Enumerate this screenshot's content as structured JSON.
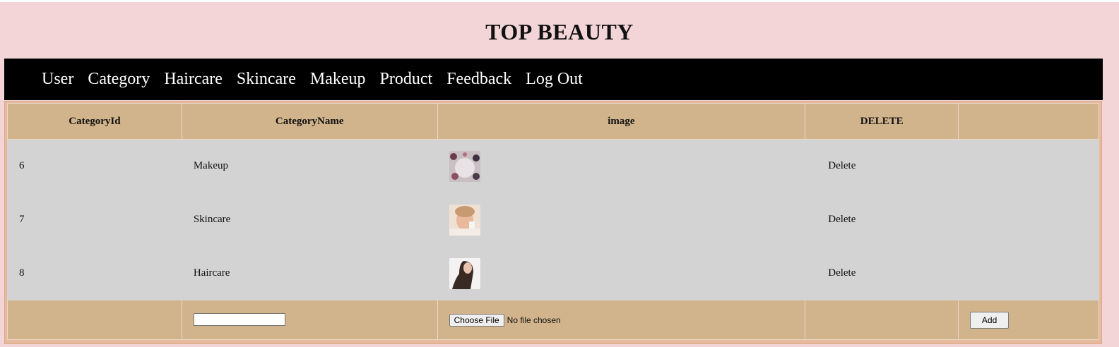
{
  "header": {
    "title": "TOP BEAUTY"
  },
  "nav": {
    "items": [
      "User",
      "Category",
      "Haircare",
      "Skincare",
      "Makeup",
      "Product",
      "Feedback",
      "Log Out"
    ]
  },
  "table": {
    "headers": [
      "CategoryId",
      "CategoryName",
      "image",
      "DELETE",
      ""
    ],
    "rows": [
      {
        "id": "6",
        "name": "Makeup",
        "delete": "Delete"
      },
      {
        "id": "7",
        "name": "Skincare",
        "delete": "Delete"
      },
      {
        "id": "8",
        "name": "Haircare",
        "delete": "Delete"
      }
    ]
  },
  "form": {
    "name_value": "",
    "file_button": "Choose File",
    "file_status": "No file chosen",
    "add_label": "Add"
  },
  "colors": {
    "page_bg": "#f3d5d8",
    "nav_bg": "#000000",
    "header_row": "#d2b48c",
    "data_row": "#d3d3d3"
  }
}
